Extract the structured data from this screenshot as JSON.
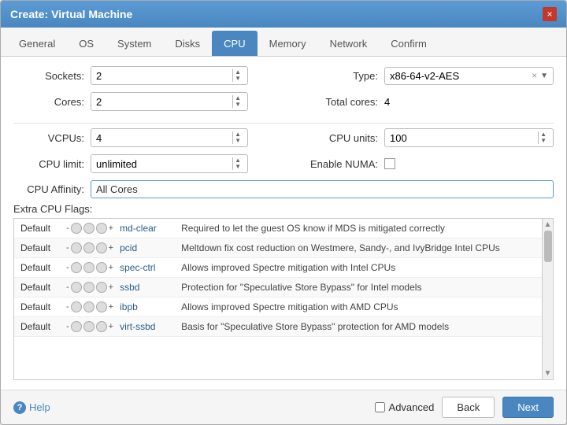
{
  "dialog": {
    "title": "Create: Virtual Machine",
    "close_icon": "×"
  },
  "tabs": [
    {
      "label": "General",
      "active": false
    },
    {
      "label": "OS",
      "active": false
    },
    {
      "label": "System",
      "active": false
    },
    {
      "label": "Disks",
      "active": false
    },
    {
      "label": "CPU",
      "active": true
    },
    {
      "label": "Memory",
      "active": false
    },
    {
      "label": "Network",
      "active": false
    },
    {
      "label": "Confirm",
      "active": false
    }
  ],
  "form": {
    "sockets_label": "Sockets:",
    "sockets_value": "2",
    "cores_label": "Cores:",
    "cores_value": "2",
    "type_label": "Type:",
    "type_value": "x86-64-v2-AES",
    "total_cores_label": "Total cores:",
    "total_cores_value": "4",
    "vcpus_label": "VCPUs:",
    "vcpus_value": "4",
    "cpu_units_label": "CPU units:",
    "cpu_units_value": "100",
    "cpu_limit_label": "CPU limit:",
    "cpu_limit_value": "unlimited",
    "enable_numa_label": "Enable NUMA:",
    "cpu_affinity_label": "CPU Affinity:",
    "cpu_affinity_value": "All Cores",
    "extra_flags_label": "Extra CPU Flags:"
  },
  "flags": [
    {
      "default": "Default",
      "name": "md-clear",
      "desc": "Required to let the guest OS know if MDS is mitigated correctly"
    },
    {
      "default": "Default",
      "name": "pcid",
      "desc": "Meltdown fix cost reduction on Westmere, Sandy-, and IvyBridge Intel CPUs"
    },
    {
      "default": "Default",
      "name": "spec-ctrl",
      "desc": "Allows improved Spectre mitigation with Intel CPUs"
    },
    {
      "default": "Default",
      "name": "ssbd",
      "desc": "Protection for \"Speculative Store Bypass\" for Intel models"
    },
    {
      "default": "Default",
      "name": "ibpb",
      "desc": "Allows improved Spectre mitigation with AMD CPUs"
    },
    {
      "default": "Default",
      "name": "virt-ssbd",
      "desc": "Basis for \"Speculative Store Bypass\" protection for AMD models"
    }
  ],
  "footer": {
    "help_label": "Help",
    "advanced_label": "Advanced",
    "back_label": "Back",
    "next_label": "Next"
  }
}
